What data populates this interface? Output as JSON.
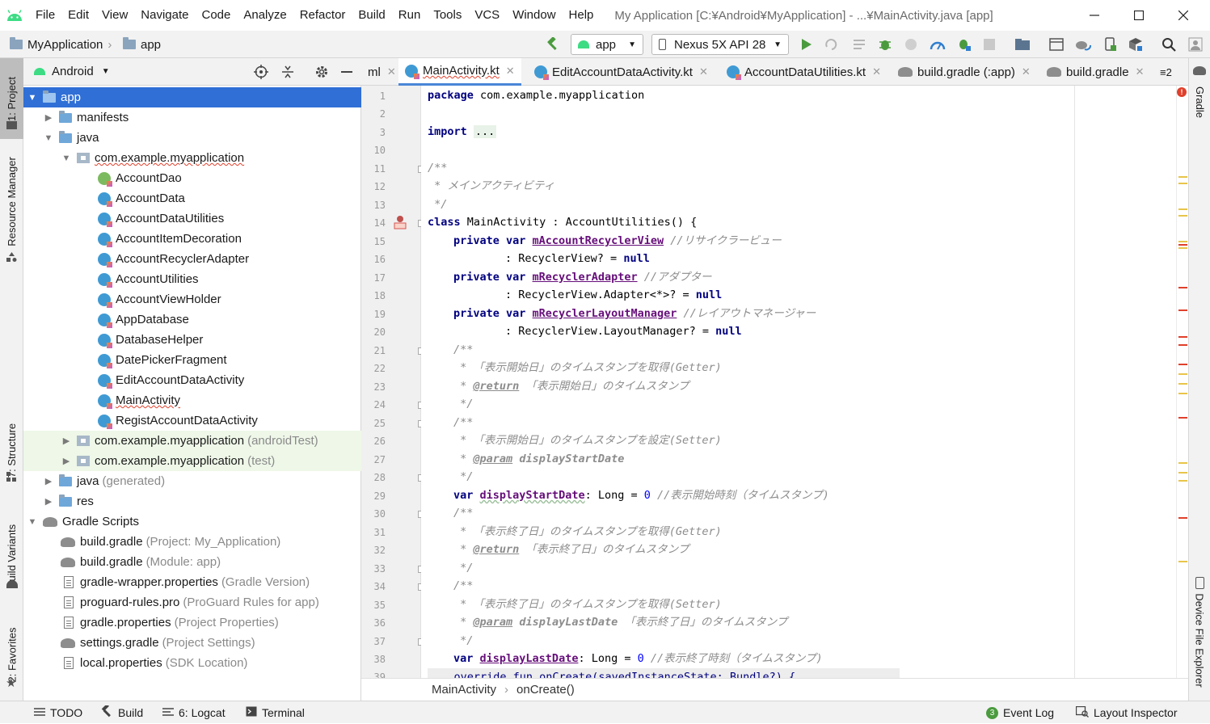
{
  "menubar": {
    "items": [
      "File",
      "Edit",
      "View",
      "Navigate",
      "Code",
      "Analyze",
      "Refactor",
      "Build",
      "Run",
      "Tools",
      "VCS",
      "Window",
      "Help"
    ],
    "window_title": "My Application [C:¥Android¥MyApplication] - ...¥MainActivity.java [app]"
  },
  "navbar": {
    "crumb_project": "MyApplication",
    "crumb_module": "app",
    "run_config": "app",
    "device": "Nexus 5X API 28"
  },
  "left_strip": {
    "project": "1: Project",
    "resource_manager": "Resource Manager",
    "structure": "7: Structure",
    "build_variants": "Build Variants",
    "favorites": "2: Favorites"
  },
  "project_panel": {
    "view_mode": "Android",
    "tree": [
      {
        "label": "app",
        "hint": ""
      },
      {
        "label": "manifests",
        "hint": ""
      },
      {
        "label": "java",
        "hint": ""
      },
      {
        "label": "com.example.myapplication",
        "hint": ""
      },
      {
        "label": "AccountDao",
        "hint": ""
      },
      {
        "label": "AccountData",
        "hint": ""
      },
      {
        "label": "AccountDataUtilities",
        "hint": ""
      },
      {
        "label": "AccountItemDecoration",
        "hint": ""
      },
      {
        "label": "AccountRecyclerAdapter",
        "hint": ""
      },
      {
        "label": "AccountUtilities",
        "hint": ""
      },
      {
        "label": "AccountViewHolder",
        "hint": ""
      },
      {
        "label": "AppDatabase",
        "hint": ""
      },
      {
        "label": "DatabaseHelper",
        "hint": ""
      },
      {
        "label": "DatePickerFragment",
        "hint": ""
      },
      {
        "label": "EditAccountDataActivity",
        "hint": ""
      },
      {
        "label": "MainActivity",
        "hint": ""
      },
      {
        "label": "RegistAccountDataActivity",
        "hint": ""
      },
      {
        "label": "com.example.myapplication",
        "hint": "(androidTest)"
      },
      {
        "label": "com.example.myapplication",
        "hint": "(test)"
      },
      {
        "label": "java",
        "hint": "(generated)"
      },
      {
        "label": "res",
        "hint": ""
      },
      {
        "label": "Gradle Scripts",
        "hint": ""
      },
      {
        "label": "build.gradle",
        "hint": "(Project: My_Application)"
      },
      {
        "label": "build.gradle",
        "hint": "(Module: app)"
      },
      {
        "label": "gradle-wrapper.properties",
        "hint": "(Gradle Version)"
      },
      {
        "label": "proguard-rules.pro",
        "hint": "(ProGuard Rules for app)"
      },
      {
        "label": "gradle.properties",
        "hint": "(Project Properties)"
      },
      {
        "label": "settings.gradle",
        "hint": "(Project Settings)"
      },
      {
        "label": "local.properties",
        "hint": "(SDK Location)"
      }
    ]
  },
  "editor_tabs": {
    "overflow_left": "ml",
    "tabs": [
      "MainActivity.kt",
      "EditAccountDataActivity.kt",
      "AccountDataUtilities.kt",
      "build.gradle (:app)",
      "build.gradle"
    ],
    "overflow_count": "≡2"
  },
  "editor": {
    "line_numbers": [
      "1",
      "2",
      "3",
      "10",
      "11",
      "12",
      "13",
      "14",
      "15",
      "16",
      "17",
      "18",
      "19",
      "20",
      "21",
      "22",
      "23",
      "24",
      "25",
      "26",
      "27",
      "28",
      "29",
      "30",
      "31",
      "32",
      "33",
      "34",
      "35",
      "36",
      "37",
      "38",
      "39"
    ],
    "code": {
      "l1_kw": "package",
      "l1_rest": " com.example.myapplication",
      "l3_kw": "import",
      "l3_fold": "...",
      "l11": "/**",
      "l12": " * メインアクティビティ",
      "l13": " */",
      "l14_kw": "class",
      "l14_rest": " MainActivity : AccountUtilities() {",
      "l15_kw": "private var",
      "l15_var": "mAccountRecyclerView",
      "l15_cm": " //リサイクラービュー",
      "l16_rest": ": RecyclerView? = ",
      "null": "null",
      "l17_var": "mRecyclerAdapter",
      "l17_cm": " //アダプター",
      "l18_rest": ": RecyclerView.Adapter<*>? = ",
      "l19_var": "mRecyclerLayoutManager",
      "l19_cm": " //レイアウトマネージャー",
      "l20_rest": ": RecyclerView.LayoutManager? = ",
      "doc_open": "/**",
      "doc_close": " */",
      "l22": " * 「表示開始日」のタイムスタンプを取得(Getter)",
      "return_tag": "@return",
      "l23_cm": " 「表示開始日」のタイムスタンプ",
      "l26": " * 「表示開始日」のタイムスタンプを設定(Setter)",
      "param_tag": "@param",
      "l27_param": "displayStartDate",
      "var_kw": "var",
      "l29_var": "displayStartDate",
      "long_assign": ": Long = ",
      "zero": "0",
      "l29_cm": " //表示開始時刻（タイムスタンプ)",
      "l31": " * 「表示終了日」のタイムスタンプを取得(Getter)",
      "l32_cm": " 「表示終了日」のタイムスタンプ",
      "l35": " * 「表示終了日」のタイムスタンプを取得(Setter)",
      "l36_param": "displayLastDate",
      "l36_cm": " 「表示終了日」のタイムスタンプ",
      "l38_var": "displayLastDate",
      "l38_cm": " //表示終了時刻（タイムスタンプ)",
      "l39": "    override fun onCreate(savedInstanceState: Bundle?) {"
    }
  },
  "breadcrumb_bar": {
    "class_name": "MainActivity",
    "method_name": "onCreate()"
  },
  "right_strip": {
    "gradle": "Gradle",
    "device_file_explorer": "Device File Explorer"
  },
  "statusbar": {
    "todo": "TODO",
    "build": "Build",
    "logcat": "6: Logcat",
    "terminal": "Terminal",
    "event_count": "3",
    "event_log": "Event Log",
    "layout_inspector": "Layout Inspector"
  },
  "colors": {
    "accent": "#2f6fd6",
    "keyword": "#000080",
    "property": "#660e7a",
    "comment": "#8c8c8c",
    "error": "#e0402b"
  }
}
